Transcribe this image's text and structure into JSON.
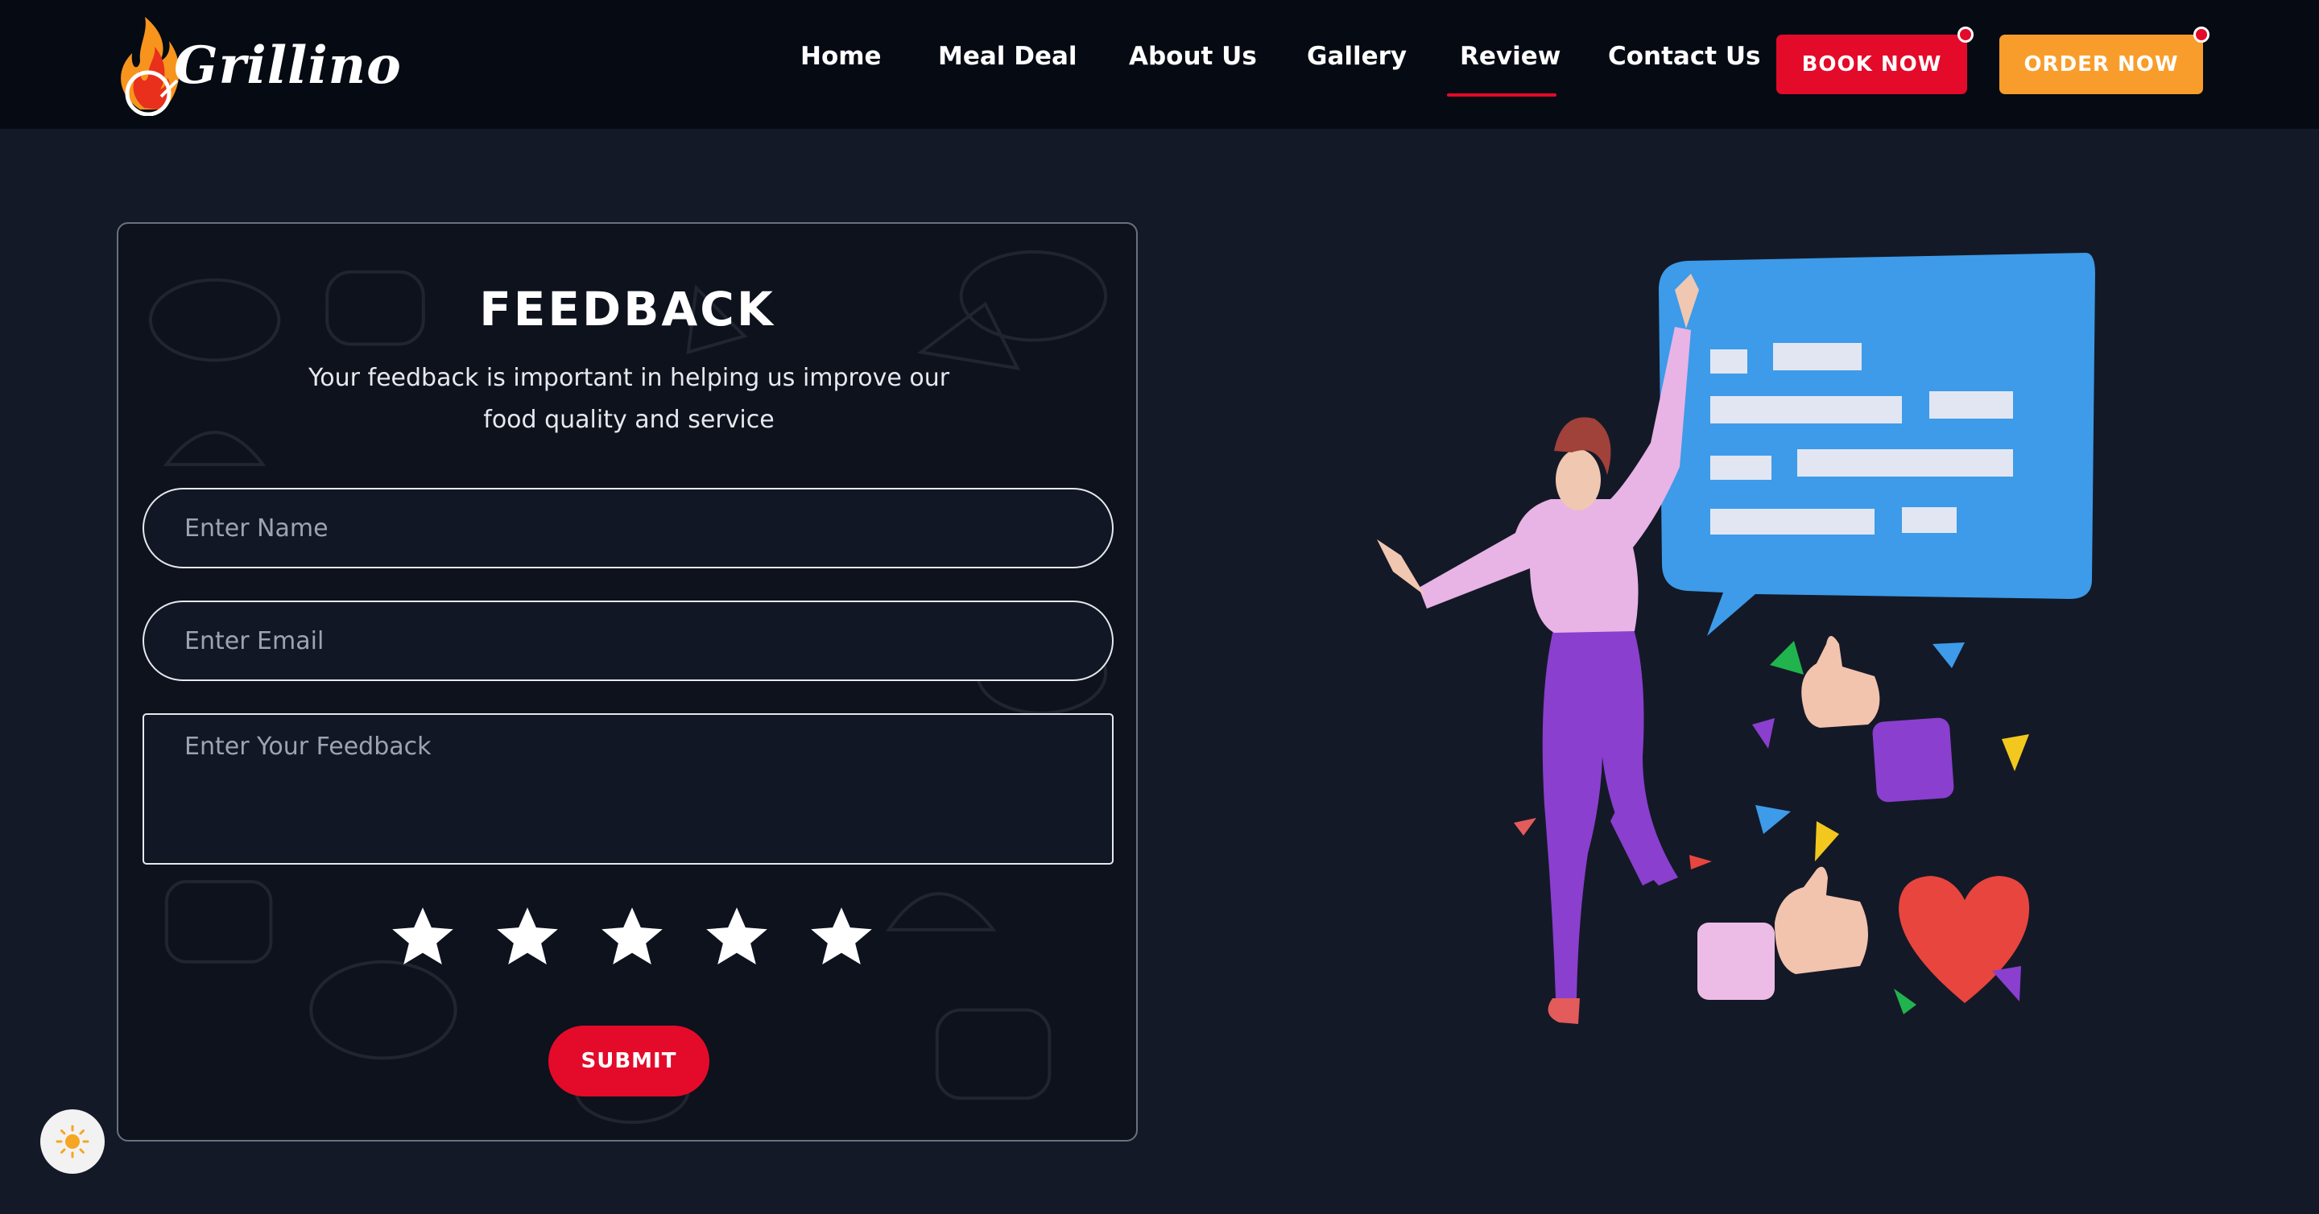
{
  "brand": {
    "name": "Grillino"
  },
  "nav": {
    "items": [
      {
        "label": "Home"
      },
      {
        "label": "Meal Deal"
      },
      {
        "label": "About Us"
      },
      {
        "label": "Gallery"
      },
      {
        "label": "Review",
        "active": true
      },
      {
        "label": "Contact Us"
      }
    ],
    "book_label": "BOOK NOW",
    "order_label": "ORDER NOW"
  },
  "feedback": {
    "title": "FEEDBACK",
    "subtitle": "Your feedback is important in helping us improve our food quality and service",
    "name_placeholder": "Enter Name",
    "email_placeholder": "Enter Email",
    "feedback_placeholder": "Enter Your Feedback",
    "rating": {
      "max": 5,
      "selected": 0
    },
    "submit_label": "SUBMIT"
  },
  "colors": {
    "accent_red": "#e40a2a",
    "accent_orange": "#f89d2b",
    "page_bg": "#141927",
    "header_bg": "#050a13"
  },
  "icons": {
    "theme_toggle": "sun-icon",
    "rating": "star-icon"
  }
}
